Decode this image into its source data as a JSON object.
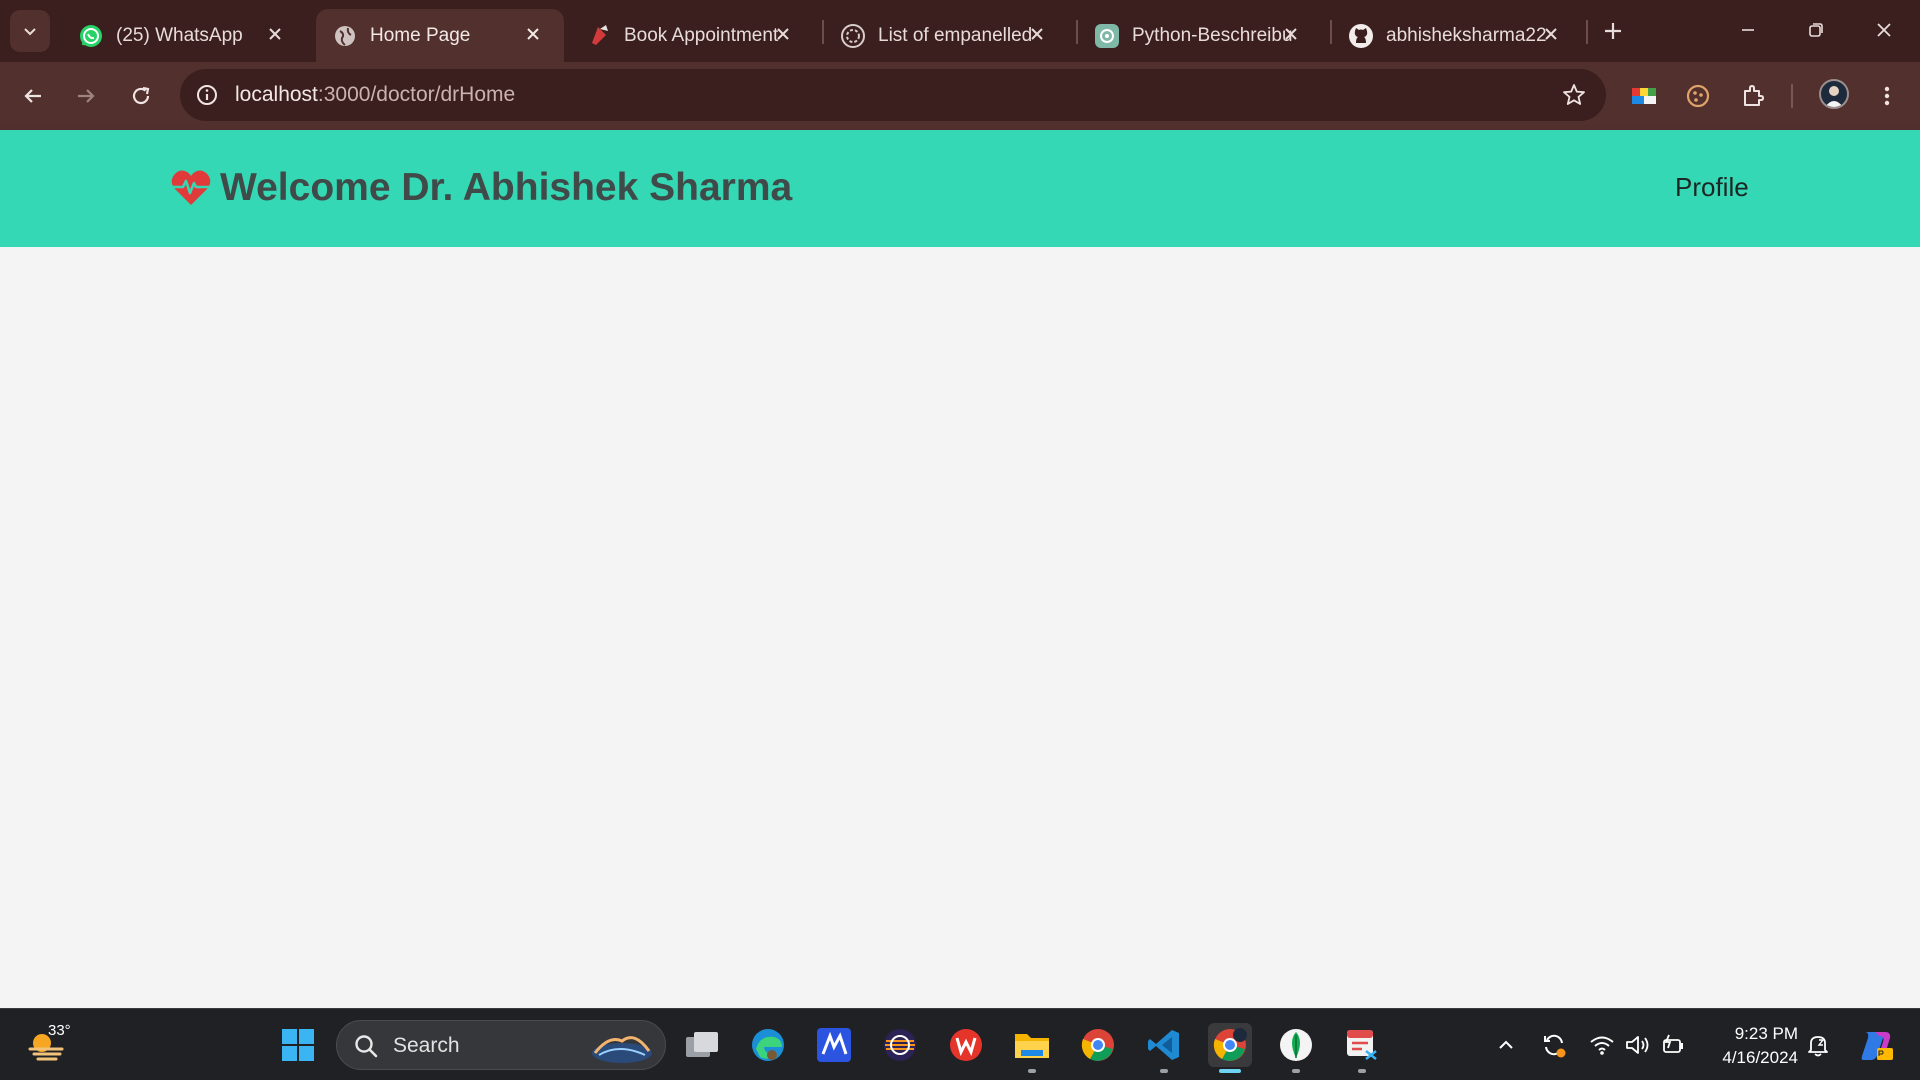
{
  "browser": {
    "tabs": [
      {
        "title": "(25) WhatsApp",
        "icon": "whatsapp-icon",
        "active": false
      },
      {
        "title": "Home Page",
        "icon": "globe-icon",
        "active": true
      },
      {
        "title": "Book Appointment",
        "icon": "book-appointment-icon",
        "active": false
      },
      {
        "title": "List of empanelled",
        "icon": "list-empanelled-icon",
        "active": false
      },
      {
        "title": "Python-Beschreibung",
        "icon": "chatgpt-icon",
        "active": false
      },
      {
        "title": "abhisheksharma22",
        "icon": "github-icon",
        "active": false
      }
    ],
    "url": {
      "host": "localhost",
      "path": ":3000/doctor/drHome"
    }
  },
  "page": {
    "header_title": "Welcome Dr. Abhishek Sharma",
    "nav_profile": "Profile",
    "accent_color": "#34d8b4",
    "heart_color": "#e03a3a"
  },
  "taskbar": {
    "weather_temp": "33°",
    "search_label": "Search",
    "time": "9:23 PM",
    "date": "4/16/2024"
  }
}
